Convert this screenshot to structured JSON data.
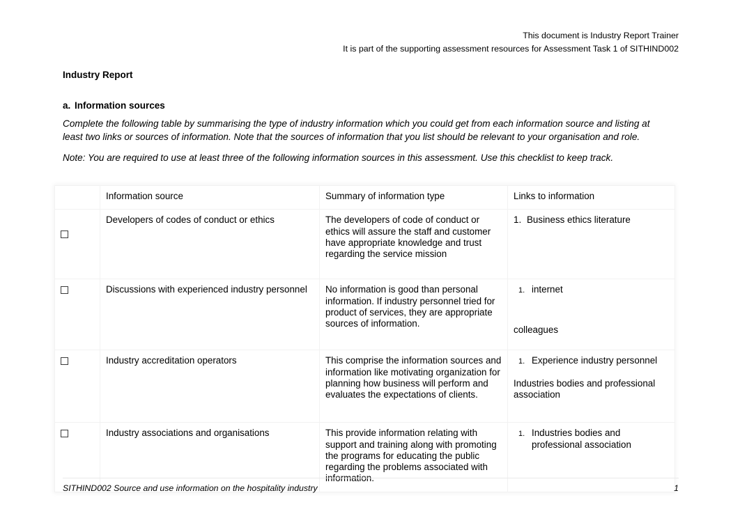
{
  "header": {
    "line1": "This document is Industry Report Trainer",
    "line2": "It is part of the supporting assessment resources for Assessment Task 1 of SITHIND002"
  },
  "document": {
    "title": "Industry Report",
    "section_marker": "a.",
    "section_heading": "Information sources",
    "instruction": "Complete the following table by summarising the type of industry information which you could get from each information source and listing at least two links or sources of information. Note that the sources of information that you list should be relevant to your organisation and role.",
    "note": "Note: You are required to use at least three of the following information sources in this assessment. Use this checklist to keep track."
  },
  "table": {
    "columns": [
      "",
      "Information source",
      "Summary of information type",
      "Links to information"
    ],
    "rows": [
      {
        "checked": false,
        "source": "Developers of codes of conduct or ethics",
        "summary": "The developers of code of conduct or ethics will assure the staff and customer have appropriate knowledge and trust regarding the service mission",
        "links": [
          {
            "num": "1.",
            "text": "Business ethics literature"
          }
        ],
        "extra_links": []
      },
      {
        "checked": false,
        "source": "Discussions with experienced industry personnel",
        "summary": "No information is good than personal information. If industry personnel tried for product of services, they are appropriate sources of information.",
        "links": [
          {
            "num": "1.",
            "text": "internet"
          }
        ],
        "extra_links": [
          "colleagues"
        ]
      },
      {
        "checked": false,
        "source": "Industry accreditation operators",
        "summary": "This comprise the information sources and information like motivating organization for planning how business will perform and evaluates the expectations of clients.",
        "links": [
          {
            "num": "1.",
            "text": "Experience industry personnel"
          }
        ],
        "extra_links": [
          "Industries bodies and professional association"
        ]
      },
      {
        "checked": false,
        "source": "Industry associations and organisations",
        "summary": "This provide information relating with support and training along with promoting the programs for educating the public regarding the problems associated with information.",
        "links": [
          {
            "num": "1.",
            "text": "Industries bodies and professional association"
          }
        ],
        "extra_links": []
      }
    ]
  },
  "footer": {
    "text": "SITHIND002 Source and use information on the hospitality industry",
    "page_number": "1"
  }
}
